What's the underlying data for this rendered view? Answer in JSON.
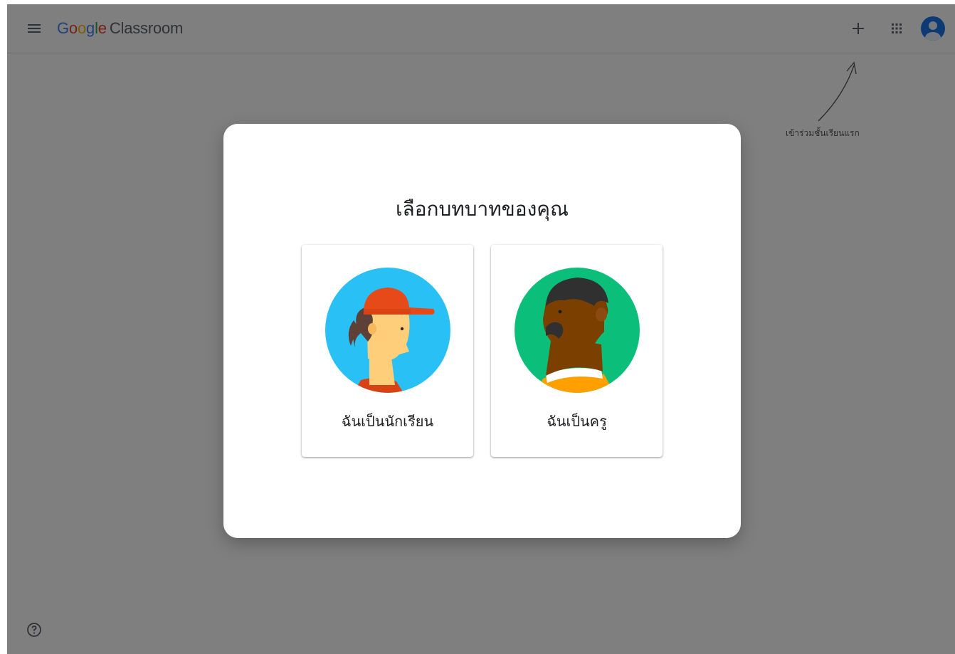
{
  "header": {
    "logo_google": [
      "G",
      "o",
      "o",
      "g",
      "l",
      "e"
    ],
    "logo_product": "Classroom"
  },
  "colors": {
    "google_blue": "#4285F4",
    "google_red": "#EA4335",
    "google_yellow": "#FBBC05",
    "google_green": "#34A853",
    "student_bg": "#29c0f5",
    "teacher_bg": "#0bbf7a"
  },
  "icons": {
    "menu": "menu-icon",
    "add": "plus-icon",
    "apps": "apps-grid-icon",
    "account": "account-avatar-icon",
    "help": "help-circle-icon",
    "hint_arrow": "arrow-icon"
  },
  "hint": {
    "text": "เข้าร่วมชั้นเรียนแรก"
  },
  "dialog": {
    "title": "เลือกบทบาทของคุณ",
    "roles": [
      {
        "label": "ฉันเป็นนักเรียน",
        "illustration": "student-illustration"
      },
      {
        "label": "ฉันเป็นครู",
        "illustration": "teacher-illustration"
      }
    ]
  }
}
